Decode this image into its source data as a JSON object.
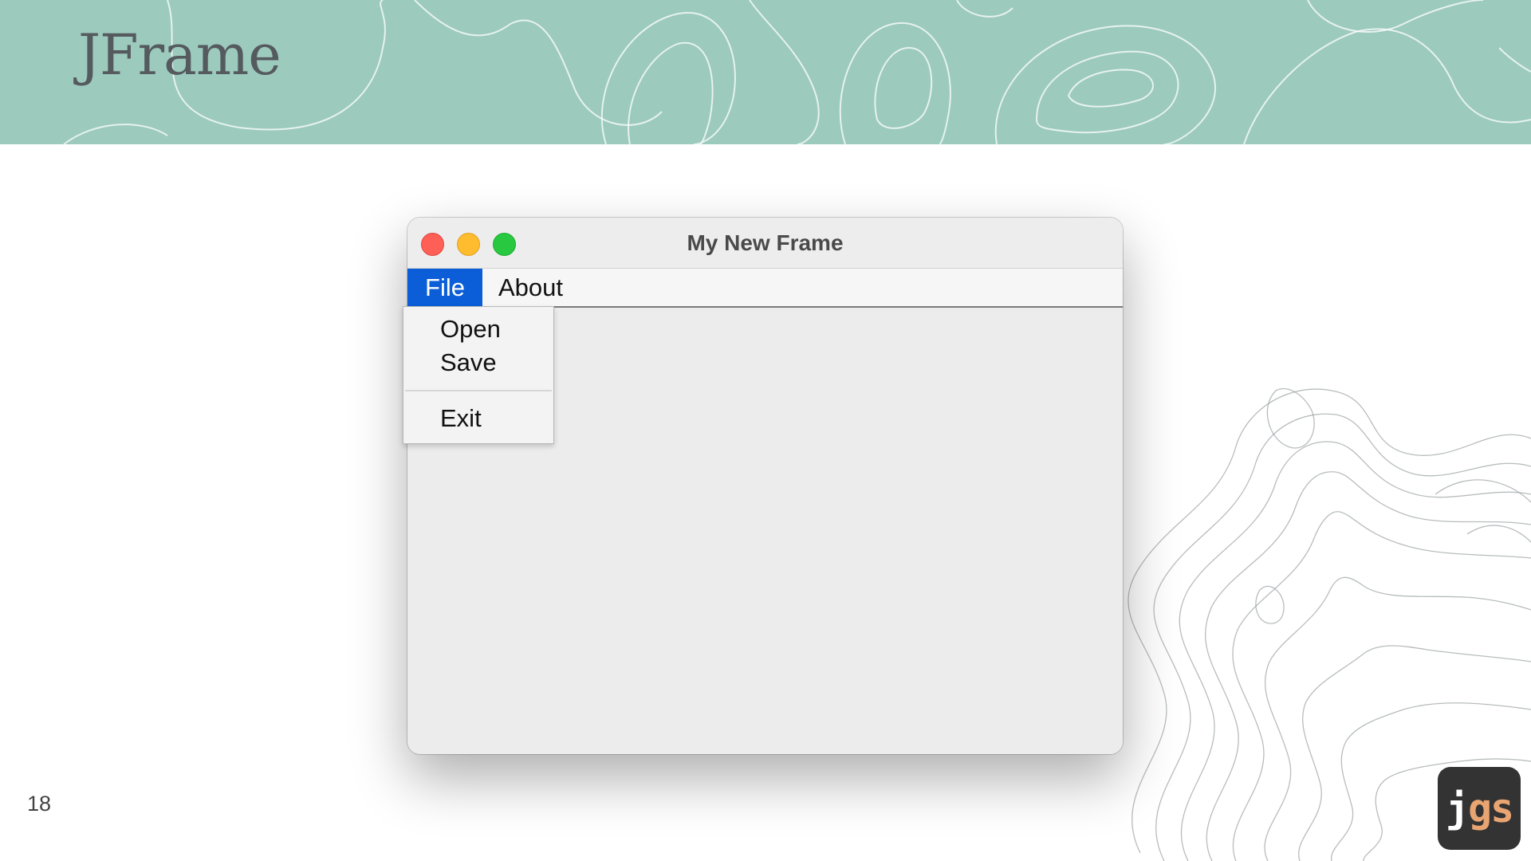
{
  "slide": {
    "title": "JFrame",
    "page_number": "18"
  },
  "logo": {
    "j": "j",
    "gs": "gs"
  },
  "window": {
    "title": "My New Frame",
    "menus": [
      {
        "label": "File",
        "active": true
      },
      {
        "label": "About",
        "active": false
      }
    ],
    "file_menu_items": [
      "Open",
      "Save",
      "Exit"
    ]
  },
  "colors": {
    "banner": "#9ccabd",
    "menu_selected": "#0b5ed7",
    "close_light": "#fe5f57",
    "minimize_light": "#febc2e",
    "zoom_light": "#28c840",
    "logo_accent": "#e8a572"
  }
}
